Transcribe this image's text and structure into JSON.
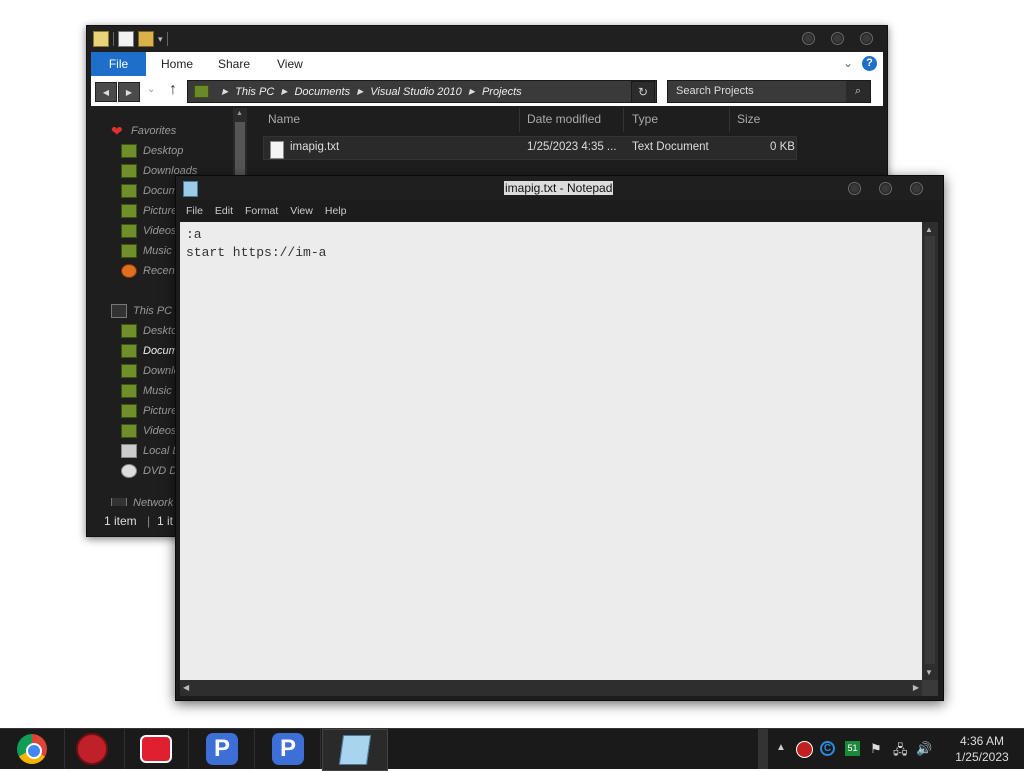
{
  "explorer": {
    "ribbon": {
      "file": "File",
      "tabs": [
        "Home",
        "Share",
        "View"
      ]
    },
    "address": {
      "crumbs": [
        "This PC",
        "Documents",
        "Visual Studio 2010",
        "Projects"
      ]
    },
    "search_placeholder": "Search Projects",
    "nav": {
      "favorites_header": "Favorites",
      "favorites": [
        "Desktop",
        "Downloads",
        "Docum",
        "Picture",
        "Videos",
        "Music",
        "Recent"
      ],
      "thispc_header": "This PC",
      "thispc": [
        "Deskto",
        "Docum",
        "Downlc",
        "Music",
        "Picture",
        "Videos",
        "Local D",
        "DVD D"
      ],
      "network": "Network"
    },
    "columns": [
      "Name",
      "Date modified",
      "Type",
      "Size"
    ],
    "files": [
      {
        "name": "imapig.txt",
        "date": "1/25/2023 4:35 ...",
        "type": "Text Document",
        "size": "0 KB"
      }
    ],
    "status": {
      "count": "1 item",
      "selected": "1 it"
    }
  },
  "notepad": {
    "title": "imapig.txt - Notepad",
    "menu": [
      "File",
      "Edit",
      "Format",
      "View",
      "Help"
    ],
    "lines": [
      ":a",
      "start https://im-a"
    ]
  },
  "taskbar": {
    "apps": [
      "chrome-icon",
      "red-gear-app-icon",
      "screen-recorder-icon",
      "p-app-icon",
      "p-app-icon",
      "notepad-icon"
    ],
    "tray": {
      "badge": "51"
    },
    "clock": {
      "time": "4:36 AM",
      "date": "1/25/2023"
    }
  },
  "colors": {
    "accent": "#1e6fc9",
    "window_dark": "#1e1e1e",
    "text_area": "#ececec"
  }
}
